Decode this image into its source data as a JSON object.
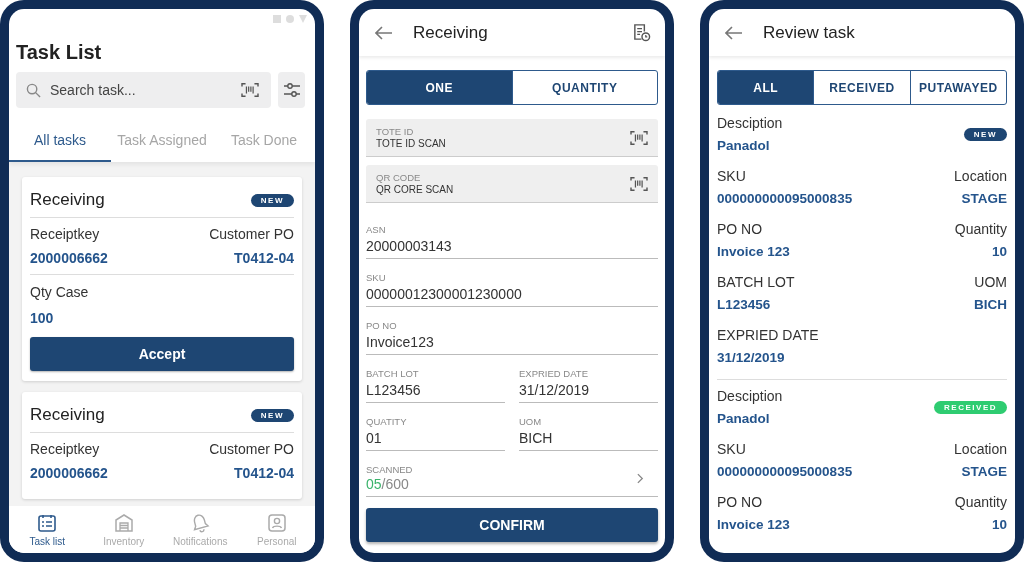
{
  "task_list_screen": {
    "title": "Task List",
    "search": {
      "placeholder": "Search task..."
    },
    "tabs": [
      {
        "label": "All tasks",
        "selected": true
      },
      {
        "label": "Task Assigned",
        "selected": false
      },
      {
        "label": "Task Done",
        "selected": false
      }
    ],
    "cards": [
      {
        "title": "Receiving",
        "badge": "NEW",
        "left_label": "Receiptkey",
        "left_value": "2000006662",
        "right_label": "Customer PO",
        "right_value": "T0412-04",
        "qty_label": "Qty Case",
        "qty_value": "100",
        "button": "Accept"
      },
      {
        "title": "Receiving",
        "badge": "NEW",
        "left_label": "Receiptkey",
        "left_value": "2000006662",
        "right_label": "Customer PO",
        "right_value": "T0412-04"
      }
    ],
    "nav": [
      {
        "kind": "tasks",
        "label": "Task list",
        "selected": true
      },
      {
        "kind": "inventory",
        "label": "Inventory",
        "selected": false
      },
      {
        "kind": "bell",
        "label": "Notifications",
        "selected": false
      },
      {
        "kind": "person",
        "label": "Personal",
        "selected": false
      }
    ]
  },
  "receiving_screen": {
    "title": "Receiving",
    "segments": [
      {
        "label": "ONE",
        "selected": true
      },
      {
        "label": "QUANTITY",
        "selected": false
      }
    ],
    "scan_fields": [
      {
        "label": "TOTE ID",
        "value": "TOTE ID SCAN"
      },
      {
        "label": "QR CODE",
        "value": "QR CORE SCAN"
      }
    ],
    "field_rows": [
      [
        {
          "label": "ASN",
          "value": "20000003143"
        }
      ],
      [
        {
          "label": "SKU",
          "value": "00000012300001230000"
        }
      ],
      [
        {
          "label": "PO NO",
          "value": "Invoice123"
        }
      ],
      [
        {
          "label": "BATCH LOT",
          "value": "L123456"
        },
        {
          "label": "EXPRIED DATE",
          "value": "31/12/2019"
        }
      ],
      [
        {
          "label": "QUATITY",
          "value": "01"
        },
        {
          "label": "UOM",
          "value": "BICH"
        }
      ]
    ],
    "scanned": {
      "label": "SCANNED",
      "count": "05",
      "total": "/600"
    },
    "button": "CONFIRM"
  },
  "review_screen": {
    "title": "Review task",
    "segments": [
      {
        "label": "ALL",
        "selected": true
      },
      {
        "label": "RECEIVED",
        "selected": false
      },
      {
        "label": "PUTAWAYED",
        "selected": false
      }
    ],
    "items": [
      {
        "description_label": "Desciption",
        "description": "Panadol",
        "badge": "NEW",
        "color": "#1e4673",
        "rows": [
          [
            {
              "label": "SKU",
              "value": "000000000095000835"
            },
            {
              "label": "Location",
              "value": "STAGE"
            }
          ],
          [
            {
              "label": "PO NO",
              "value": "Invoice 123"
            },
            {
              "label": "Quantity",
              "value": "10"
            }
          ],
          [
            {
              "label": "BATCH LOT",
              "value": "L123456"
            },
            {
              "label": "UOM",
              "value": "BICH"
            }
          ],
          [
            {
              "label": "EXPRIED DATE",
              "value": "31/12/2019"
            }
          ]
        ]
      },
      {
        "description_label": "Desciption",
        "description": "Panadol",
        "badge": "RECEIVED",
        "color": "#2ecc71",
        "rows": [
          [
            {
              "label": "SKU",
              "value": "000000000095000835"
            },
            {
              "label": "Location",
              "value": "STAGE"
            }
          ],
          [
            {
              "label": "PO NO",
              "value": "Invoice 123"
            },
            {
              "label": "Quantity",
              "value": "10"
            }
          ]
        ]
      }
    ]
  }
}
